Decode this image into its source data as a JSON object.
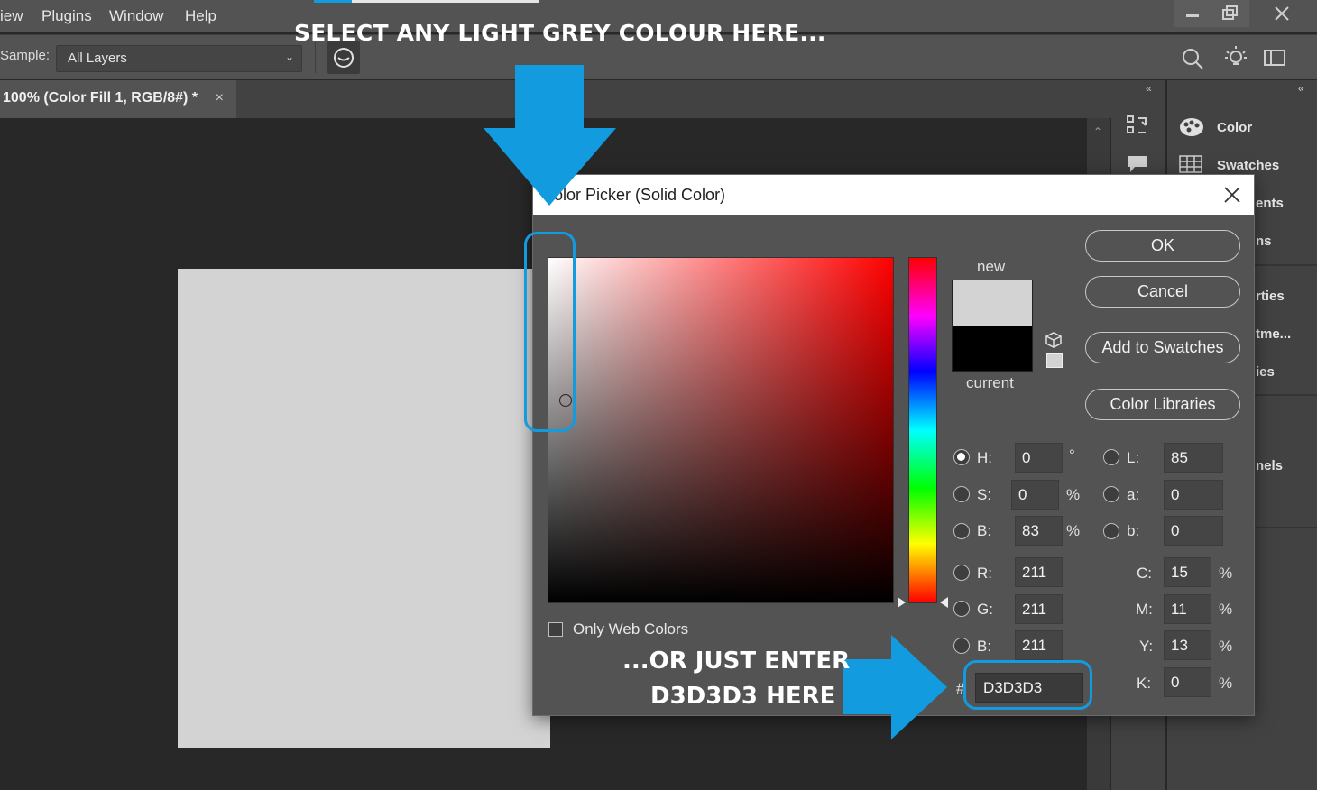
{
  "menubar": {
    "items": [
      "iew",
      "Plugins",
      "Window",
      "Help"
    ]
  },
  "options_bar": {
    "sample_label": "Sample:",
    "sample_value": "All Layers"
  },
  "document_tab": {
    "title": "100% (Color Fill 1, RGB/8#) *",
    "close_glyph": "×"
  },
  "panels": {
    "collapse_glyph": "«",
    "items": [
      "Color",
      "Swatches",
      "ents",
      "ns",
      "rties",
      "tme...",
      "ies",
      "nels"
    ]
  },
  "annotations": {
    "top": "SELECT ANY LIGHT GREY COLOUR HERE...",
    "bottom_line1": "...OR JUST ENTER",
    "bottom_line2": "D3D3D3 HERE",
    "color": "#129bde"
  },
  "dialog": {
    "title": "Color Picker (Solid Color)",
    "new_label": "new",
    "current_label": "current",
    "new_color": "#d3d3d3",
    "current_color": "#000000",
    "buttons": {
      "ok": "OK",
      "cancel": "Cancel",
      "add_to_swatches": "Add to Swatches",
      "color_libraries": "Color Libraries"
    },
    "only_web_colors": "Only Web Colors",
    "hsb": {
      "h_label": "H:",
      "h_value": "0",
      "h_unit": "°",
      "s_label": "S:",
      "s_value": "0",
      "s_unit": "%",
      "b_label": "B:",
      "b_value": "83",
      "b_unit": "%"
    },
    "rgb": {
      "r_label": "R:",
      "r_value": "211",
      "g_label": "G:",
      "g_value": "211",
      "b_label": "B:",
      "b_value": "211"
    },
    "lab": {
      "l_label": "L:",
      "l_value": "85",
      "a_label": "a:",
      "a_value": "0",
      "b_label": "b:",
      "b_value": "0"
    },
    "cmyk": {
      "c_label": "C:",
      "c_value": "15",
      "m_label": "M:",
      "m_value": "11",
      "y_label": "Y:",
      "y_value": "13",
      "k_label": "K:",
      "k_value": "0",
      "unit": "%"
    },
    "hex_prefix": "#",
    "hex_value": "D3D3D3"
  }
}
